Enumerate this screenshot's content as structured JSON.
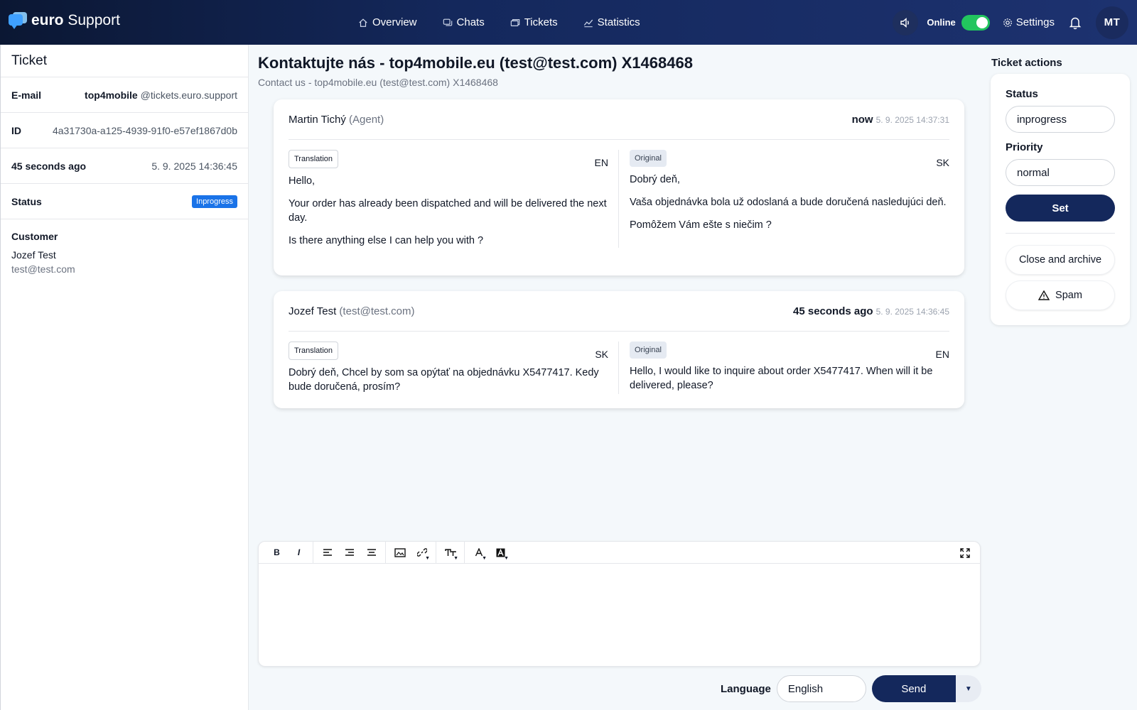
{
  "app": {
    "logo_bold": "euro",
    "logo_light": " Support"
  },
  "nav": [
    {
      "label": "Overview",
      "icon": "home-icon"
    },
    {
      "label": "Chats",
      "icon": "chat-icon"
    },
    {
      "label": "Tickets",
      "icon": "ticket-icon"
    },
    {
      "label": "Statistics",
      "icon": "chart-icon"
    }
  ],
  "topbar": {
    "online_label": "Online",
    "settings_label": "Settings",
    "avatar_initials": "MT"
  },
  "ticket": {
    "title": "Ticket",
    "email_label": "E-mail",
    "email_user": "top4mobile",
    "email_domain": " @tickets.euro.support",
    "id_label": "ID",
    "id_value": "4a31730a-a125-4939-91f0-e57ef1867d0b",
    "age_label": "45 seconds ago",
    "age_value": "5. 9. 2025 14:36:45",
    "status_label": "Status",
    "status_value": "Inprogress",
    "customer_label": "Customer",
    "customer_name": "Jozef Test",
    "customer_email": "test@test.com"
  },
  "main": {
    "title": "Kontaktujte nás - top4mobile.eu (test@test.com) X1468468",
    "subtitle": "Contact us - top4mobile.eu (test@test.com) X1468468"
  },
  "messages": [
    {
      "author": "Martin Tichý",
      "role": " (Agent)",
      "ago": "now",
      "timestamp": "5. 9. 2025 14:37:31",
      "translation_tag": "Translation",
      "translation_lang": "EN",
      "translation_p1": "Hello,",
      "translation_p2": "Your order has already been dispatched and will be delivered the next day.",
      "translation_p3": "Is there anything else I can help you with ?",
      "original_tag": "Original",
      "original_lang": "SK",
      "original_p1": "Dobrý deň,",
      "original_p2": "Vaša objednávka bola už odoslaná a bude doručená nasledujúci deň.",
      "original_p3": "Pomôžem Vám ešte s niečim ?"
    },
    {
      "author": "Jozef Test",
      "role": " (test@test.com)",
      "ago": "45 seconds ago",
      "timestamp": "5. 9. 2025 14:36:45",
      "translation_tag": "Translation",
      "translation_lang": "SK",
      "translation_p1": "Dobrý deň, Chcel by som sa opýtať na objednávku X5477417. Kedy bude doručená, prosím?",
      "original_tag": "Original",
      "original_lang": "EN",
      "original_p1": "Hello, I would like to inquire about order X5477417. When will it be delivered, please?"
    }
  ],
  "editor": {
    "toolbar": [
      "B",
      "I"
    ]
  },
  "composer": {
    "language_label": "Language",
    "language_value": "English",
    "send_label": "Send"
  },
  "actions": {
    "title": "Ticket actions",
    "status_label": "Status",
    "status_value": "inprogress",
    "priority_label": "Priority",
    "priority_value": "normal",
    "set_label": "Set",
    "close_label": "Close and archive",
    "spam_label": "Spam"
  },
  "colors": {
    "brand": "#14285c",
    "accent_blue": "#1a73e8",
    "online_green": "#22c55e"
  }
}
